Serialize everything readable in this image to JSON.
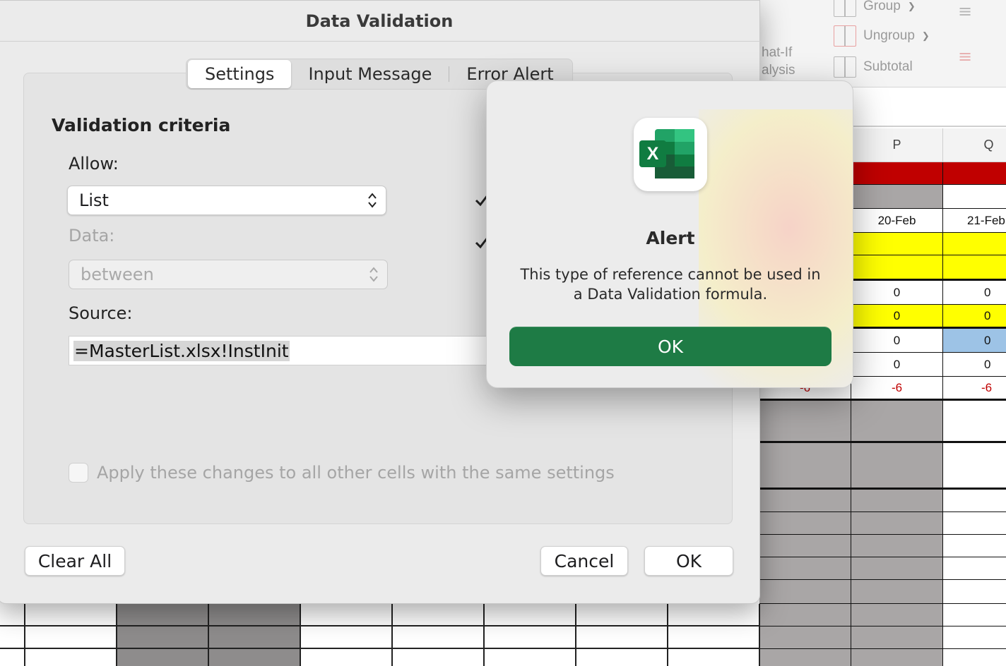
{
  "ribbon": {
    "what_if_line1": "hat-If",
    "what_if_line2": "alysis",
    "group_label": "Group",
    "ungroup_label": "Ungroup",
    "subtotal_label": "Subtotal"
  },
  "sheet": {
    "col_p": "P",
    "col_q": "Q",
    "date_p": "20-Feb",
    "date_q": "21-Feb",
    "zero": "0",
    "neg": "-6"
  },
  "dialog": {
    "title": "Data Validation",
    "tabs": [
      "Settings",
      "Input Message",
      "Error Alert"
    ],
    "validation_criteria": "Validation criteria",
    "allow_label": "Allow:",
    "allow_value": "List",
    "data_label": "Data:",
    "data_value": "between",
    "source_label": "Source:",
    "source_value": "=MasterList.xlsx!InstInit",
    "apply_label": "Apply these changes to all other cells with the same settings",
    "clear_all": "Clear All",
    "cancel": "Cancel",
    "ok": "OK"
  },
  "alert": {
    "title": "Alert",
    "message_line1": "This type of reference cannot be used in",
    "message_line2": "a Data Validation formula.",
    "ok": "OK",
    "icon": "excel-app-icon",
    "accent": "#1e7b45"
  }
}
